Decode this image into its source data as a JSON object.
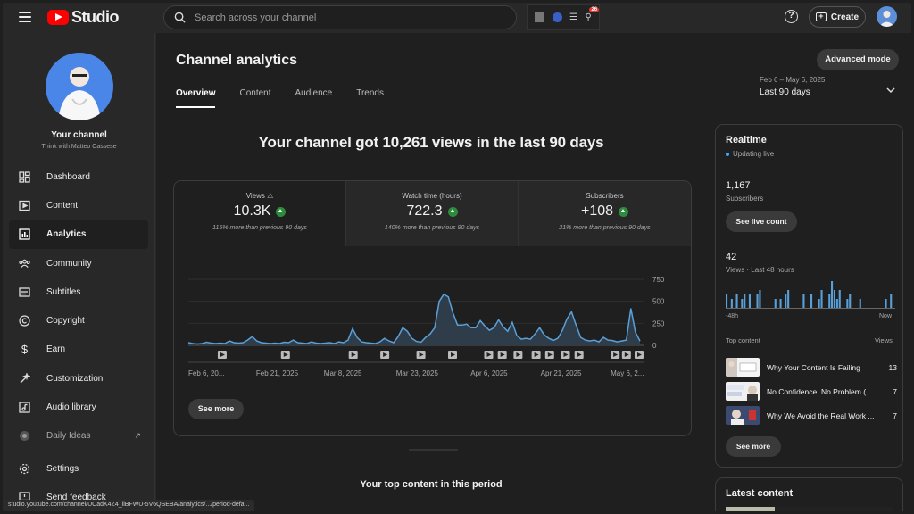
{
  "app": {
    "name": "Studio"
  },
  "search": {
    "placeholder": "Search across your channel"
  },
  "header": {
    "create_label": "Create",
    "help": "?"
  },
  "sidebar": {
    "channel_name": "Your channel",
    "channel_handle": "Think with Matteo Cassese",
    "items": [
      {
        "label": "Dashboard",
        "icon": "dashboard-icon"
      },
      {
        "label": "Content",
        "icon": "content-icon"
      },
      {
        "label": "Analytics",
        "icon": "analytics-icon",
        "active": true
      },
      {
        "label": "Community",
        "icon": "community-icon"
      },
      {
        "label": "Subtitles",
        "icon": "subtitles-icon"
      },
      {
        "label": "Copyright",
        "icon": "copyright-icon"
      },
      {
        "label": "Earn",
        "icon": "earn-icon"
      },
      {
        "label": "Customization",
        "icon": "customization-icon"
      },
      {
        "label": "Audio library",
        "icon": "audio-library-icon"
      },
      {
        "label": "Daily Ideas",
        "icon": "daily-ideas-icon"
      },
      {
        "label": "Settings",
        "icon": "settings-icon"
      },
      {
        "label": "Send feedback",
        "icon": "feedback-icon"
      }
    ]
  },
  "main": {
    "title": "Channel analytics",
    "advanced_mode": "Advanced mode",
    "tabs": [
      "Overview",
      "Content",
      "Audience",
      "Trends"
    ],
    "active_tab": "Overview",
    "date_range": {
      "dates": "Feb 6 – May 6, 2025",
      "label": "Last 90 days"
    },
    "headline": "Your channel got 10,261 views in the last 90 days",
    "metrics": [
      {
        "title": "Views",
        "value": "10.3K",
        "comparison": "115% more than previous 90 days"
      },
      {
        "title": "Watch time (hours)",
        "value": "722.3",
        "comparison": "140% more than previous 90 days"
      },
      {
        "title": "Subscribers",
        "value": "+108",
        "comparison": "21% more than previous 90 days"
      }
    ],
    "see_more": "See more",
    "top_content_title": "Your top content in this period"
  },
  "chart_data": {
    "type": "area",
    "x_tick_labels": [
      "Feb 6, 20...",
      "Feb 21, 2025",
      "Mar 8, 2025",
      "Mar 23, 2025",
      "Apr 6, 2025",
      "Apr 21, 2025",
      "May 6, 2..."
    ],
    "y_ticks": [
      0,
      250,
      500,
      750
    ],
    "ylim": [
      0,
      750
    ],
    "series": [
      {
        "values": [
          30,
          20,
          15,
          20,
          35,
          25,
          20,
          25,
          20,
          50,
          30,
          25,
          30,
          60,
          100,
          50,
          30,
          25,
          20,
          25,
          20,
          35,
          30,
          60,
          30,
          25,
          20,
          40,
          25,
          20,
          25,
          30,
          20,
          40,
          30,
          60,
          190,
          90,
          40,
          30,
          25,
          20,
          40,
          80,
          50,
          30,
          100,
          200,
          160,
          80,
          45,
          35,
          90,
          130,
          200,
          500,
          580,
          550,
          370,
          230,
          230,
          240,
          200,
          200,
          280,
          220,
          170,
          200,
          290,
          210,
          160,
          260,
          110,
          70,
          80,
          70,
          130,
          200,
          120,
          80,
          55,
          80,
          170,
          300,
          380,
          230,
          90,
          60,
          50,
          60,
          40,
          90,
          60,
          55,
          40,
          50,
          60,
          420,
          150,
          50
        ]
      }
    ],
    "color": "#5aa0d8",
    "grid": true
  },
  "realtime": {
    "title": "Realtime",
    "status": "Updating live",
    "subscribers_value": "1,167",
    "subscribers_label": "Subscribers",
    "live_count_button": "See live count",
    "views_value": "42",
    "views_label": "Views · Last 48 hours",
    "axis_left": "-48h",
    "axis_right": "Now",
    "bar_values": [
      3,
      0,
      2,
      0,
      3,
      0,
      2,
      3,
      0,
      3,
      0,
      0,
      3,
      4,
      0,
      0,
      0,
      0,
      0,
      2,
      0,
      2,
      0,
      3,
      4,
      0,
      0,
      0,
      0,
      0,
      3,
      0,
      0,
      3,
      0,
      0,
      2,
      4,
      0,
      0,
      3,
      6,
      4,
      2,
      4,
      0,
      0,
      2,
      3,
      0,
      0,
      0,
      2,
      0,
      0,
      0,
      0,
      0,
      0,
      0,
      0,
      0,
      2,
      0,
      3,
      0
    ],
    "top_content_header": "Top content",
    "views_header": "Views",
    "items": [
      {
        "title": "Why Your Content Is Failing",
        "views": "13"
      },
      {
        "title": "No Confidence, No Problem (...",
        "views": "7"
      },
      {
        "title": "Why We Avoid the Real Work ...",
        "views": "7"
      }
    ],
    "see_more": "See more"
  },
  "latest": {
    "title": "Latest content"
  },
  "status_url": "studio.youtube.com/channel/UCadK4Z4_iiBFWU-5V6QSEBA/analytics/.../period-defa..."
}
